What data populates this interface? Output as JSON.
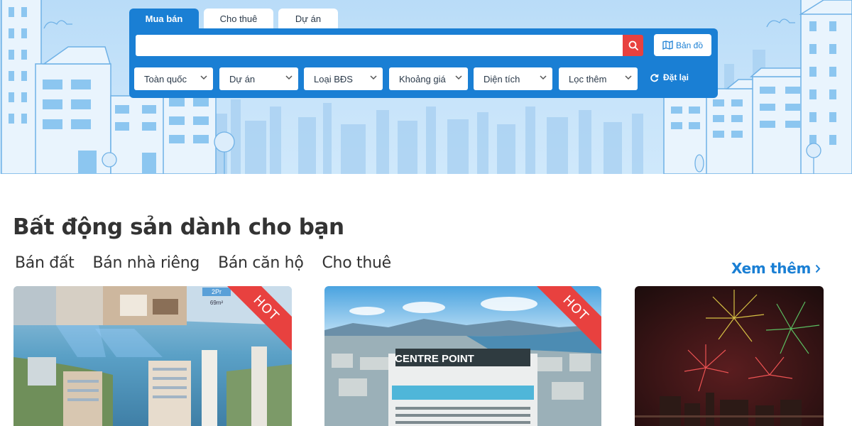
{
  "search": {
    "tabs": [
      {
        "label": "Mua bán",
        "active": true
      },
      {
        "label": "Cho thuê",
        "active": false
      },
      {
        "label": "Dự án",
        "active": false
      }
    ],
    "input_value": "",
    "input_placeholder": "",
    "map_label": "Bản đồ",
    "filters": [
      "Toàn quốc",
      "Dự án",
      "Loại BĐS",
      "Khoảng giá",
      "Diện tích",
      "Lọc thêm"
    ],
    "reset_label": "Đặt lại"
  },
  "section": {
    "title": "Bất động sản dành cho bạn",
    "categories": [
      "Bán đất",
      "Bán nhà riêng",
      "Bán căn hộ",
      "Cho thuê"
    ],
    "see_more": "Xem thêm"
  },
  "cards": [
    {
      "badge": "HOT",
      "inset_label": "2Pr",
      "inset_area": "69m²"
    },
    {
      "badge": "HOT",
      "sign": "CENTRE POINT"
    },
    {
      "badge": ""
    }
  ],
  "colors": {
    "primary": "#1a7fd4",
    "accent": "#e8413f",
    "hero_sky": "#c8e4fa",
    "text": "#333333"
  }
}
